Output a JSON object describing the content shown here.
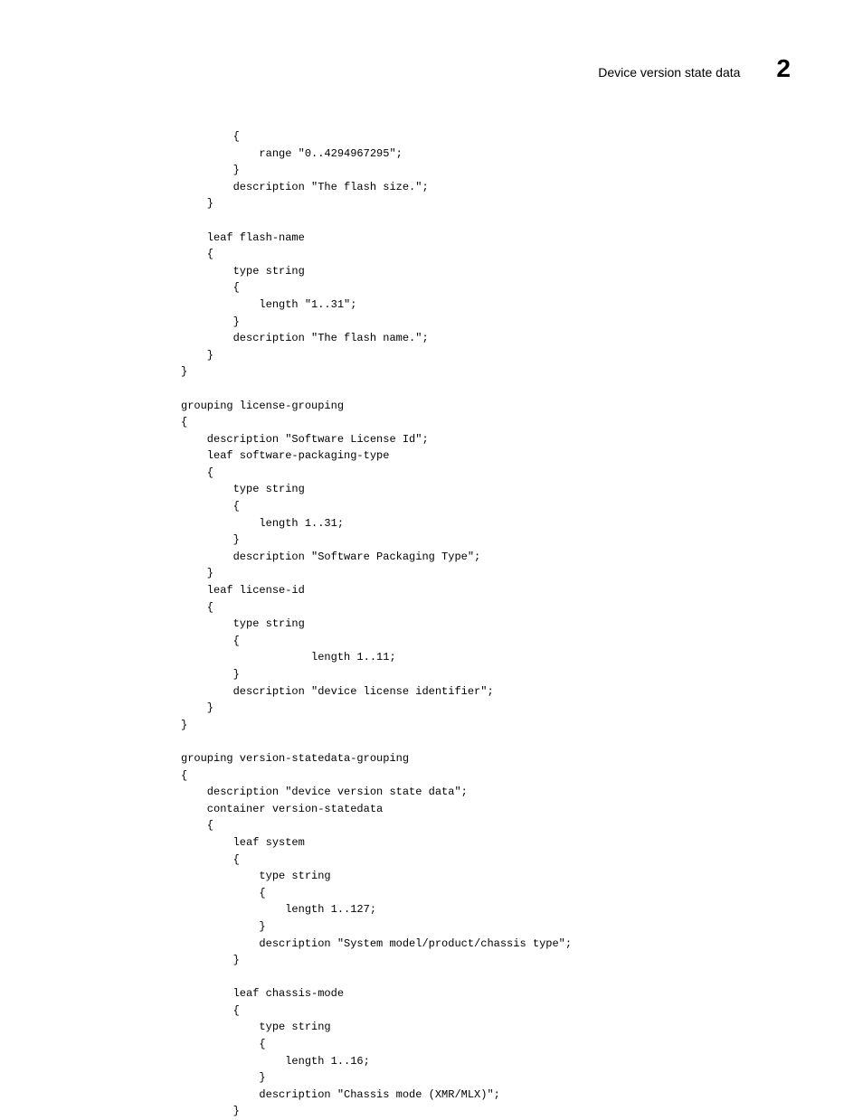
{
  "header": {
    "title": "Device version state data",
    "chapter": "2"
  },
  "code": "        {\n            range \"0..4294967295\";\n        }\n        description \"The flash size.\";\n    }\n\n    leaf flash-name\n    {\n        type string\n        {\n            length \"1..31\";\n        }\n        description \"The flash name.\";\n    }\n}\n\ngrouping license-grouping\n{\n    description \"Software License Id\";\n    leaf software-packaging-type\n    {\n        type string\n        {\n            length 1..31;\n        }\n        description \"Software Packaging Type\";\n    }\n    leaf license-id\n    {\n        type string\n        {\n                    length 1..11;\n        }\n        description \"device license identifier\";\n    }\n}\n\ngrouping version-statedata-grouping\n{\n    description \"device version state data\";\n    container version-statedata\n    {\n        leaf system\n        {\n            type string\n            {\n                length 1..127;\n            }\n            description \"System model/product/chassis type\";\n        }\n\n        leaf chassis-mode\n        {\n            type string\n            {\n                length 1..16;\n            }\n            description \"Chassis mode (XMR/MLX)\";\n        }"
}
